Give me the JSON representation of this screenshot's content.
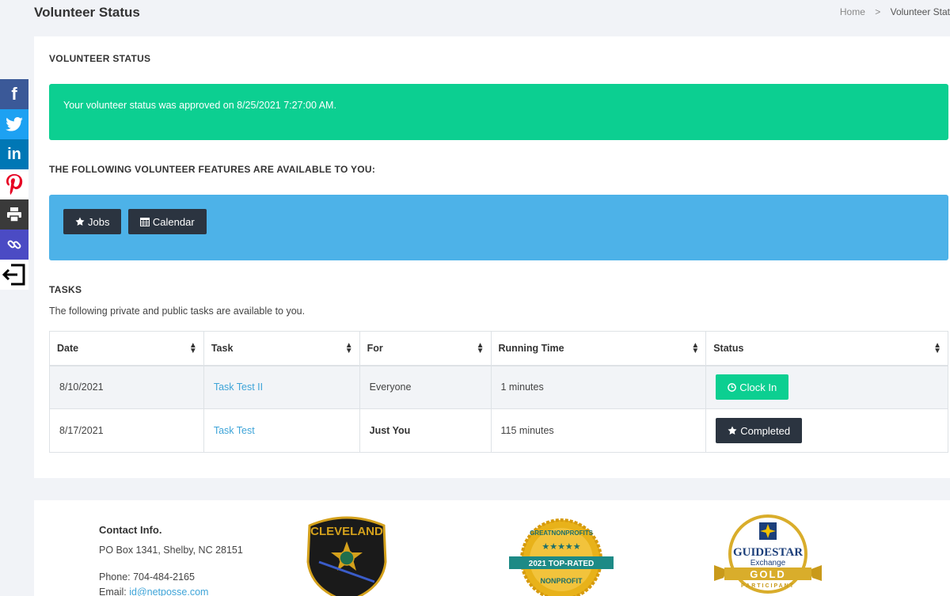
{
  "header": {
    "title": "Volunteer Status",
    "breadcrumb": {
      "home": "Home",
      "separator": ">",
      "current": "Volunteer Stat"
    }
  },
  "status_section": {
    "title": "VOLUNTEER STATUS",
    "message": "Your volunteer status was approved on 8/25/2021 7:27:00 AM."
  },
  "features_section": {
    "title": "THE FOLLOWING VOLUNTEER FEATURES ARE AVAILABLE TO YOU:",
    "buttons": [
      {
        "label": "Jobs",
        "icon": "star-icon"
      },
      {
        "label": "Calendar",
        "icon": "calendar-icon"
      }
    ]
  },
  "tasks_section": {
    "title": "TASKS",
    "description": "The following private and public tasks are available to you.",
    "columns": [
      "Date",
      "Task",
      "For",
      "Running Time",
      "Status"
    ],
    "rows": [
      {
        "date": "8/10/2021",
        "task": "Task Test II",
        "for": "Everyone",
        "running_time": "1 minutes",
        "status": "Clock In",
        "status_icon": "clock-icon"
      },
      {
        "date": "8/17/2021",
        "task": "Task Test",
        "for": "Just You",
        "running_time": "115 minutes",
        "status": "Completed",
        "status_icon": "star-icon"
      }
    ]
  },
  "social": [
    "facebook-icon",
    "twitter-icon",
    "linkedin-icon",
    "pinterest-icon",
    "print-icon",
    "link-icon",
    "exit-icon"
  ],
  "footer": {
    "contact_title": "Contact Info.",
    "address": "PO Box 1341, Shelby, NC 28151",
    "phone": "Phone: 704-484-2165",
    "email_label": "Email:",
    "email": "id@netposse.com",
    "logo1_text": "CLEVELAND",
    "logo2_top": "GREATNONPROFITS",
    "logo2_banner": "2021 TOP-RATED",
    "logo2_bottom": "NONPROFIT",
    "logo3_name": "GUIDESTAR",
    "logo3_sub": "Exchange",
    "logo3_level": "GOLD",
    "logo3_part": "PARTICIPANT"
  },
  "colors": {
    "success": "#0ccf91",
    "info": "#4db2e8",
    "dark_button": "#2b3440",
    "link": "#3ea4d8"
  }
}
